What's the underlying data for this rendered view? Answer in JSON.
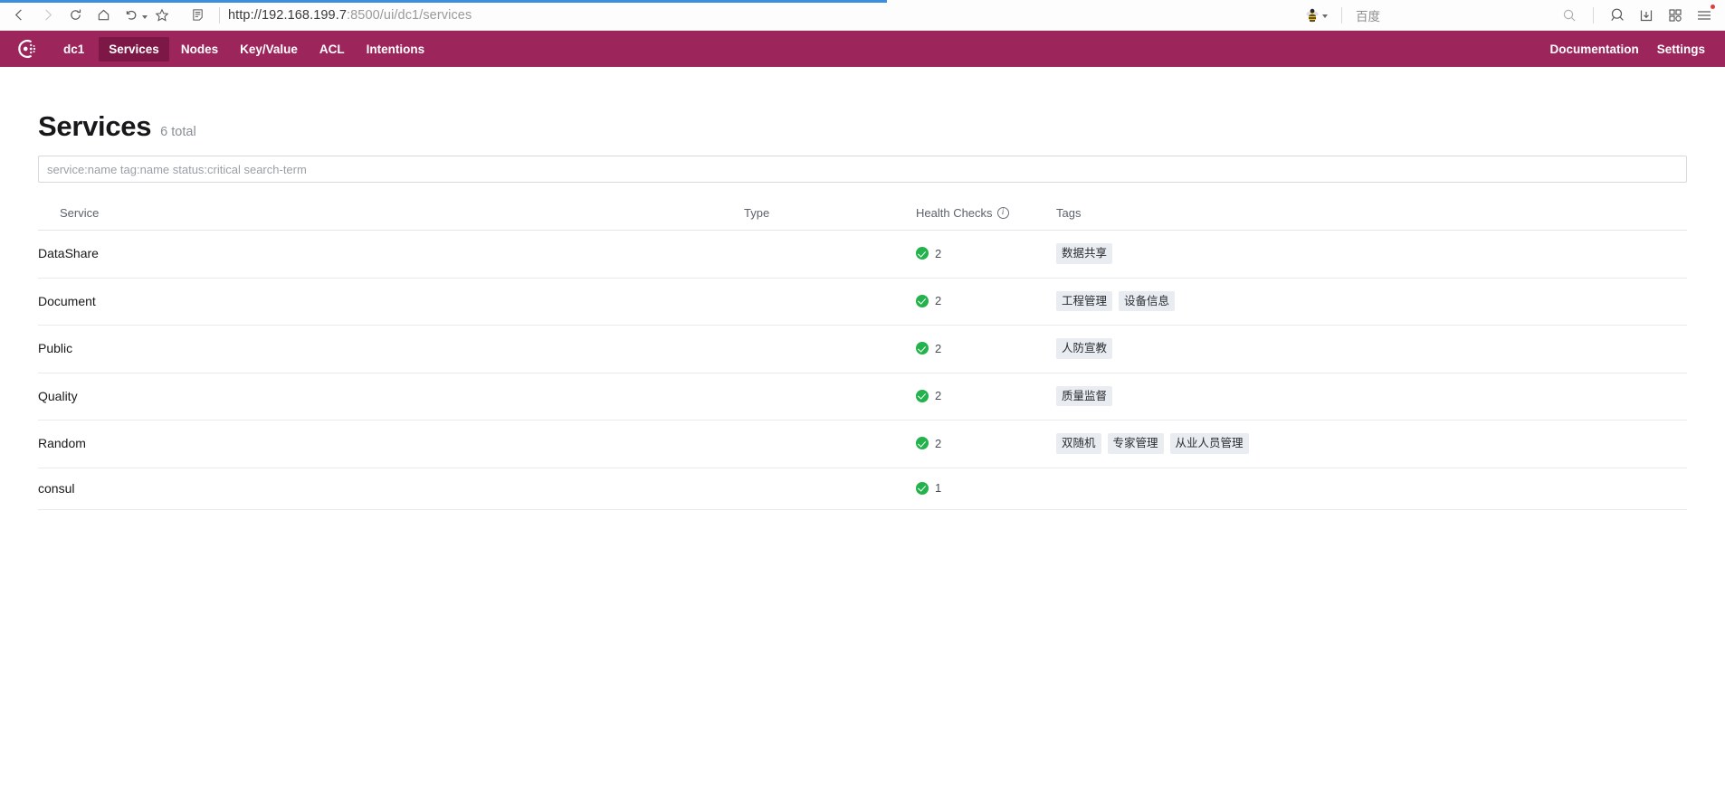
{
  "browser": {
    "url_scheme_host": "http://192.168.199.7",
    "url_rest": ":8500/ui/dc1/services",
    "url_full": "http://192.168.199.7:8500/ui/dc1/services",
    "search_engine": "百度",
    "icons": {
      "back": "back-arrow-icon",
      "forward": "forward-arrow-icon",
      "reload": "reload-icon",
      "home": "home-icon",
      "history": "history-undo-icon",
      "bookmark": "star-bookmark-icon",
      "reader": "reader-view-icon",
      "engine": "baidu-bee-icon",
      "engine_caret": "chevron-down-icon",
      "search": "search-icon",
      "lens": "search-lens-icon",
      "download": "download-icon",
      "apps": "apps-grid-icon",
      "menu": "hamburger-menu-icon"
    }
  },
  "app": {
    "brand_color": "#9c255b",
    "brand_active_color": "#7c1746",
    "logo_name": "consul-logo-icon",
    "datacenter": "dc1",
    "nav_items": [
      {
        "label": "Services",
        "active": true
      },
      {
        "label": "Nodes",
        "active": false
      },
      {
        "label": "Key/Value",
        "active": false
      },
      {
        "label": "ACL",
        "active": false
      },
      {
        "label": "Intentions",
        "active": false
      }
    ],
    "nav_right": [
      {
        "label": "Documentation"
      },
      {
        "label": "Settings"
      }
    ]
  },
  "main": {
    "title": "Services",
    "count_label": "6 total",
    "search": {
      "value": "",
      "placeholder": "service:name tag:name status:critical search-term"
    },
    "table": {
      "columns": [
        "Service",
        "Type",
        "Health Checks",
        "Tags"
      ],
      "health_info_glyph": "i",
      "rows": [
        {
          "service": "DataShare",
          "type": "",
          "health_status": "passing",
          "health_count": "2",
          "tags": [
            "数据共享"
          ]
        },
        {
          "service": "Document",
          "type": "",
          "health_status": "passing",
          "health_count": "2",
          "tags": [
            "工程管理",
            "设备信息"
          ]
        },
        {
          "service": "Public",
          "type": "",
          "health_status": "passing",
          "health_count": "2",
          "tags": [
            "人防宣教"
          ]
        },
        {
          "service": "Quality",
          "type": "",
          "health_status": "passing",
          "health_count": "2",
          "tags": [
            "质量监督"
          ]
        },
        {
          "service": "Random",
          "type": "",
          "health_status": "passing",
          "health_count": "2",
          "tags": [
            "双随机",
            "专家管理",
            "从业人员管理"
          ]
        },
        {
          "service": "consul",
          "type": "",
          "health_status": "passing",
          "health_count": "1",
          "tags": []
        }
      ]
    }
  }
}
